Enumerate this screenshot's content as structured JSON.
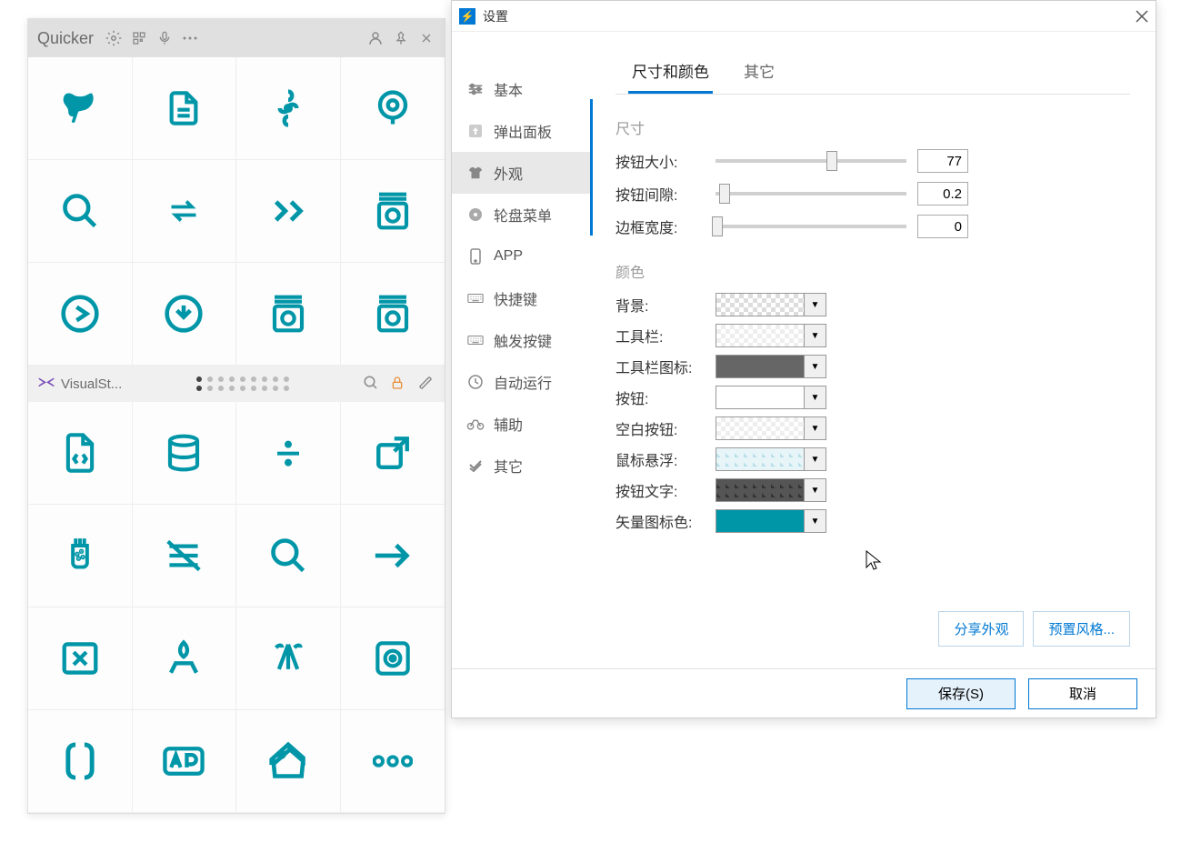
{
  "quicker": {
    "title": "Quicker",
    "divider_label": "VisualSt..."
  },
  "settings": {
    "title": "设置",
    "sidebar": {
      "items": [
        {
          "label": "基本",
          "icon": "sliders"
        },
        {
          "label": "弹出面板",
          "icon": "upload"
        },
        {
          "label": "外观",
          "icon": "shirt"
        },
        {
          "label": "轮盘菜单",
          "icon": "disc"
        },
        {
          "label": "APP",
          "icon": "phone"
        },
        {
          "label": "快捷键",
          "icon": "keyboard"
        },
        {
          "label": "触发按键",
          "icon": "keyboard"
        },
        {
          "label": "自动运行",
          "icon": "clock"
        },
        {
          "label": "辅助",
          "icon": "bike"
        },
        {
          "label": "其它",
          "icon": "check"
        }
      ]
    },
    "tabs": {
      "size_color": "尺寸和颜色",
      "other": "其它"
    },
    "sections": {
      "size": "尺寸",
      "color": "颜色"
    },
    "size_fields": {
      "button_size": {
        "label": "按钮大小:",
        "value": "77"
      },
      "button_gap": {
        "label": "按钮间隙:",
        "value": "0.2"
      },
      "border_width": {
        "label": "边框宽度:",
        "value": "0"
      }
    },
    "color_fields": {
      "background": "背景:",
      "toolbar": "工具栏:",
      "toolbar_icon": "工具栏图标:",
      "button": "按钮:",
      "empty_button": "空白按钮:",
      "hover": "鼠标悬浮:",
      "button_text": "按钮文字:",
      "vector_icon": "矢量图标色:"
    },
    "links": {
      "share": "分享外观",
      "preset": "预置风格..."
    },
    "footer": {
      "save": "保存(S)",
      "cancel": "取消"
    }
  }
}
